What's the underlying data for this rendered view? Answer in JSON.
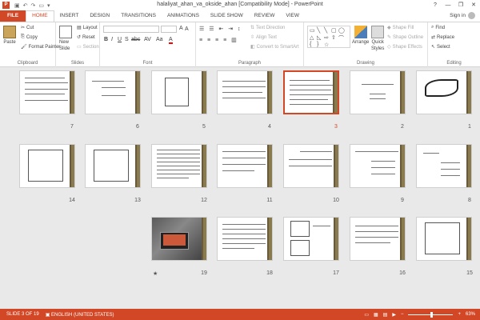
{
  "window": {
    "title": "halaliyat_ahan_va_okside_ahan [Compatibility Mode] - PowerPoint",
    "app_icon": "P",
    "controls": [
      "?",
      "—",
      "❐",
      "✕"
    ]
  },
  "quick_access": [
    "save-icon",
    "undo-icon",
    "redo-icon",
    "present-icon",
    "customize-icon"
  ],
  "tabs": [
    "FILE",
    "HOME",
    "INSERT",
    "DESIGN",
    "TRANSITIONS",
    "ANIMATIONS",
    "SLIDE SHOW",
    "REVIEW",
    "VIEW"
  ],
  "active_tab": "HOME",
  "account": {
    "label": "Sign in"
  },
  "ribbon": {
    "clipboard": {
      "paste": "Paste",
      "cut": "Cut",
      "copy": "Copy",
      "format_painter": "Format Painter",
      "label": "Clipboard"
    },
    "slides": {
      "new_slide": "New",
      "new_slide_2": "Slide",
      "layout": "Layout",
      "reset": "Reset",
      "section": "Section",
      "label": "Slides"
    },
    "font": {
      "label": "Font",
      "bold": "B",
      "italic": "I",
      "underline": "U",
      "shadow": "S",
      "strike": "abc",
      "spacing": "AV",
      "case": "Aa",
      "color": "A"
    },
    "paragraph": {
      "text_direction": "Text Direction",
      "align_text": "Align Text",
      "convert_smartart": "Convert to SmartArt",
      "label": "Paragraph"
    },
    "drawing": {
      "arrange": "Arrange",
      "quick_styles": "Quick",
      "quick_styles_2": "Styles",
      "shape_fill": "Shape Fill",
      "shape_outline": "Shape Outline",
      "shape_effects": "Shape Effects",
      "label": "Drawing"
    },
    "editing": {
      "find": "Find",
      "replace": "Replace",
      "select": "Select",
      "label": "Editing"
    }
  },
  "slides": [
    {
      "num": "1"
    },
    {
      "num": "2"
    },
    {
      "num": "3",
      "selected": true
    },
    {
      "num": "4"
    },
    {
      "num": "5"
    },
    {
      "num": "6"
    },
    {
      "num": "7"
    },
    {
      "num": "8"
    },
    {
      "num": "9"
    },
    {
      "num": "10"
    },
    {
      "num": "11"
    },
    {
      "num": "12"
    },
    {
      "num": "13"
    },
    {
      "num": "14"
    },
    {
      "num": "15"
    },
    {
      "num": "16"
    },
    {
      "num": "17"
    },
    {
      "num": "18"
    },
    {
      "num": "19",
      "transition_mark": "★"
    }
  ],
  "status": {
    "slide_indicator": "SLIDE 3 OF 19",
    "language": "ENGLISH (UNITED STATES)",
    "zoom": "63%"
  },
  "colors": {
    "accent": "#d24726",
    "sorter_bg": "#e9e9e9",
    "slide_bar": "#6b5a3a"
  }
}
